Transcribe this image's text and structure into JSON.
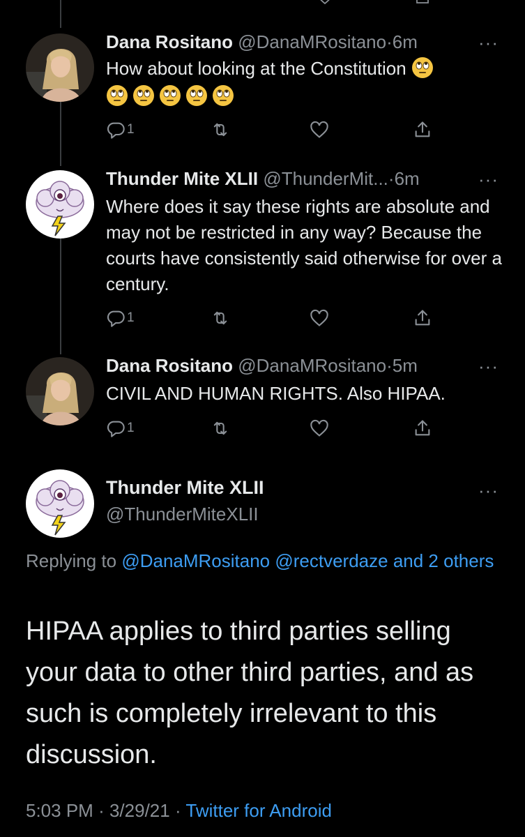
{
  "tweets": [
    {
      "name": "Dana Rositano",
      "handle": "@DanaMRositano",
      "time": "6m",
      "text": "How about looking at the Constitution",
      "reply_count": "1",
      "avatar": "woman-photo-avatar"
    },
    {
      "name": "Thunder Mite XLII",
      "handle": "@ThunderMit...",
      "time": "6m",
      "text": "Where does it say these rights are absolute and may not be restricted in any way? Because the courts have consistently said otherwise for over a century.",
      "reply_count": "1",
      "avatar": "cloud-lightning-avatar"
    },
    {
      "name": "Dana Rositano",
      "handle": "@DanaMRositano",
      "time": "5m",
      "text": "CIVIL AND HUMAN RIGHTS. Also HIPAA.",
      "reply_count": "1",
      "avatar": "woman-photo-avatar"
    }
  ],
  "separator": "·",
  "more_label": "···",
  "main_tweet": {
    "name": "Thunder Mite XLII",
    "handle": "@ThunderMiteXLII",
    "replying_prefix": "Replying to",
    "replying_mentions": "@DanaMRositano @rectverdaze and 2 others",
    "text": "HIPAA applies to third parties selling your data to other third parties, and as such is completely irrelevant to this discussion.",
    "time": "5:03 PM",
    "date": "3/29/21",
    "source": "Twitter for Android"
  },
  "colors": {
    "background": "#000000",
    "text": "#e7e9ea",
    "secondary": "#8b9096",
    "link": "#3d9df2"
  }
}
